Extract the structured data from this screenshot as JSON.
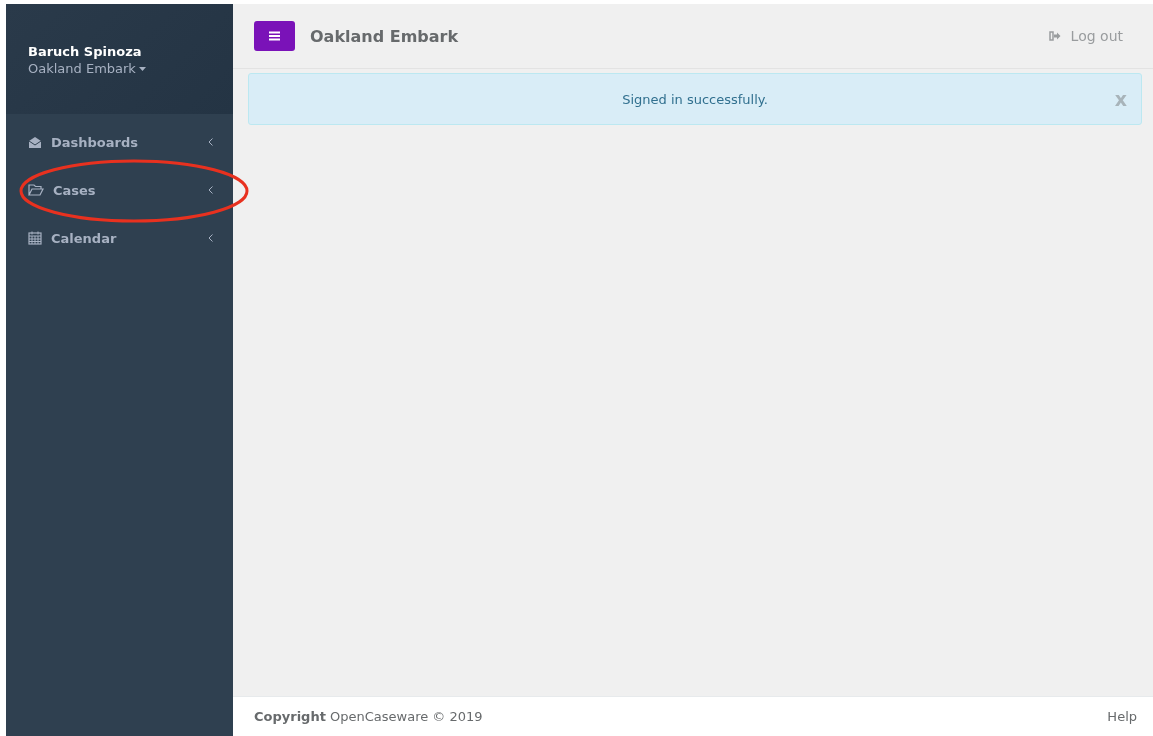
{
  "profile": {
    "name": "Baruch Spinoza",
    "organization": "Oakland Embark"
  },
  "sidebar": {
    "items": [
      {
        "kind": "dashboard",
        "label": "Dashboards",
        "expanded": false,
        "highlighted": false
      },
      {
        "kind": "folder",
        "label": "Cases",
        "expanded": false,
        "highlighted": true
      },
      {
        "kind": "calendar",
        "label": "Calendar",
        "expanded": false,
        "highlighted": false
      }
    ]
  },
  "header": {
    "title": "Oakland Embark",
    "logout": "Log out"
  },
  "alert": {
    "message": "Signed in successfully.",
    "close": "x"
  },
  "footer": {
    "copyright": "**Copyright** OpenCaseware © 2019",
    "help": "Help"
  }
}
